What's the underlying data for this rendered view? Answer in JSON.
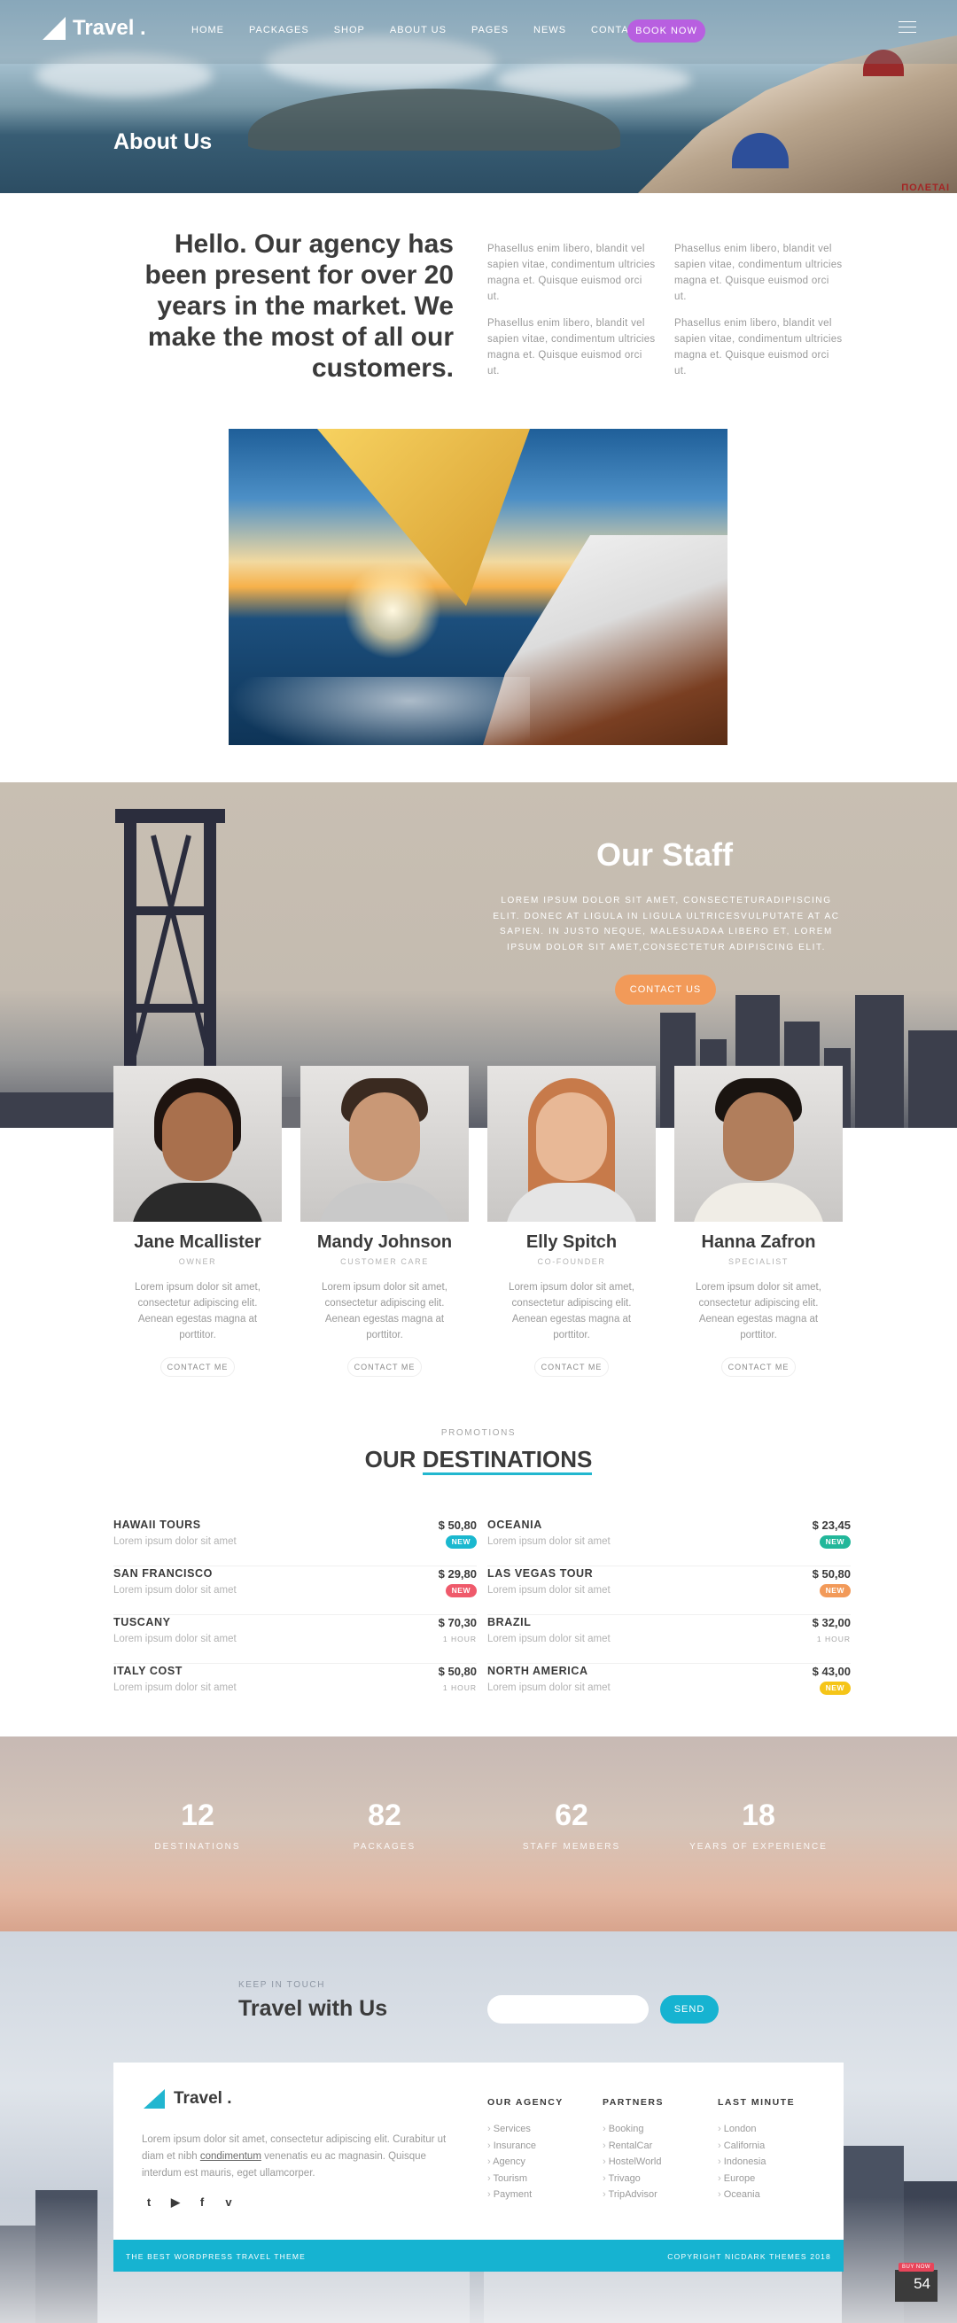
{
  "nav": {
    "logo": "Travel .",
    "items": [
      "HOME",
      "PACKAGES",
      "SHOP",
      "ABOUT US",
      "PAGES",
      "NEWS",
      "CONTACT"
    ],
    "book_now": "BOOK NOW"
  },
  "hero": {
    "title": "About Us",
    "sign": "ΠΟΛΕΤΑΙ"
  },
  "intro": {
    "headline": "Hello. Our agency has been present for over 20 years in the market. We make the most of all our customers.",
    "paragraphs": [
      "Phasellus enim libero, blandit vel sapien vitae, condimentum ultricies magna et. Quisque euismod orci ut.",
      "Phasellus enim libero, blandit vel sapien vitae, condimentum ultricies magna et. Quisque euismod orci ut.",
      "Phasellus enim libero, blandit vel sapien vitae, condimentum ultricies magna et. Quisque euismod orci ut.",
      "Phasellus enim libero, blandit vel sapien vitae, condimentum ultricies magna et. Quisque euismod orci ut."
    ]
  },
  "staff": {
    "title": "Our Staff",
    "text": "LOREM IPSUM DOLOR SIT AMET, CONSECTETURADIPISCING ELIT. DONEC AT LIGULA IN LIGULA ULTRICESVULPUTATE AT AC SAPIEN. IN JUSTO NEQUE, MALESUADAA LIBERO ET, LOREM IPSUM DOLOR SIT AMET,CONSECTETUR ADIPISCING ELIT.",
    "contact_us": "CONTACT US",
    "members": [
      {
        "name": "Jane Mcallister",
        "role": "OWNER",
        "bio": "Lorem ipsum dolor sit amet, consectetur adipiscing elit. Aenean egestas magna at porttitor.",
        "button": "CONTACT ME"
      },
      {
        "name": "Mandy Johnson",
        "role": "CUSTOMER CARE",
        "bio": "Lorem ipsum dolor sit amet, consectetur adipiscing elit. Aenean egestas magna at porttitor.",
        "button": "CONTACT ME"
      },
      {
        "name": "Elly Spitch",
        "role": "CO-FOUNDER",
        "bio": "Lorem ipsum dolor sit amet, consectetur adipiscing elit. Aenean egestas magna at porttitor.",
        "button": "CONTACT ME"
      },
      {
        "name": "Hanna Zafron",
        "role": "SPECIALIST",
        "bio": "Lorem ipsum dolor sit amet, consectetur adipiscing elit. Aenean egestas magna at porttitor.",
        "button": "CONTACT ME"
      }
    ]
  },
  "destinations": {
    "eyebrow": "PROMOTIONS",
    "title_a": "OUR",
    "title_b": "DESTINATIONS",
    "left": [
      {
        "name": "HAWAII TOURS",
        "price": "$ 50,80",
        "desc": "Lorem ipsum dolor sit amet",
        "badge": "NEW",
        "badge_color": "#1ab8cf"
      },
      {
        "name": "SAN FRANCISCO",
        "price": "$ 29,80",
        "desc": "Lorem ipsum dolor sit amet",
        "badge": "NEW",
        "badge_color": "#ef5a6b"
      },
      {
        "name": "TUSCANY",
        "price": "$ 70,30",
        "desc": "Lorem ipsum dolor sit amet",
        "badge": "1 HOUR",
        "badge_color": ""
      },
      {
        "name": "ITALY COST",
        "price": "$ 50,80",
        "desc": "Lorem ipsum dolor sit amet",
        "badge": "1 HOUR",
        "badge_color": ""
      }
    ],
    "right": [
      {
        "name": "OCEANIA",
        "price": "$ 23,45",
        "desc": "Lorem ipsum dolor sit amet",
        "badge": "NEW",
        "badge_color": "#22b79a"
      },
      {
        "name": "LAS VEGAS TOUR",
        "price": "$ 50,80",
        "desc": "Lorem ipsum dolor sit amet",
        "badge": "NEW",
        "badge_color": "#f29a59"
      },
      {
        "name": "BRAZIL",
        "price": "$ 32,00",
        "desc": "Lorem ipsum dolor sit amet",
        "badge": "1 HOUR",
        "badge_color": ""
      },
      {
        "name": "NORTH AMERICA",
        "price": "$ 43,00",
        "desc": "Lorem ipsum dolor sit amet",
        "badge": "NEW",
        "badge_color": "#f5c518"
      }
    ]
  },
  "stats": [
    {
      "value": "12",
      "label": "DESTINATIONS"
    },
    {
      "value": "82",
      "label": "PACKAGES"
    },
    {
      "value": "62",
      "label": "STAFF MEMBERS"
    },
    {
      "value": "18",
      "label": "YEARS OF EXPERIENCE"
    }
  ],
  "newsletter": {
    "eyebrow": "KEEP IN TOUCH",
    "title": "Travel with Us",
    "placeholder": "",
    "send": "SEND"
  },
  "footer": {
    "logo": "Travel .",
    "about_a": "Lorem ipsum dolor sit amet, consectetur adipiscing elit. Curabitur ut diam et nibh",
    "about_link": "condimentum",
    "about_b": "venenatis eu ac magnasin. Quisque interdum est mauris, eget ullamcorper.",
    "social": [
      "twitter-icon",
      "youtube-icon",
      "facebook-icon",
      "vimeo-icon"
    ],
    "columns": [
      {
        "title": "OUR AGENCY",
        "links": [
          "Services",
          "Insurance",
          "Agency",
          "Tourism",
          "Payment"
        ]
      },
      {
        "title": "PARTNERS",
        "links": [
          "Booking",
          "RentalCar",
          "HostelWorld",
          "Trivago",
          "TripAdvisor"
        ]
      },
      {
        "title": "LAST MINUTE",
        "links": [
          "London",
          "California",
          "Indonesia",
          "Europe",
          "Oceania"
        ]
      }
    ],
    "bar_left": "THE BEST WORDPRESS TRAVEL THEME",
    "bar_right": "COPYRIGHT NICDARK THEMES 2018"
  },
  "widget": {
    "tag": "BUY NOW",
    "count": "54"
  }
}
